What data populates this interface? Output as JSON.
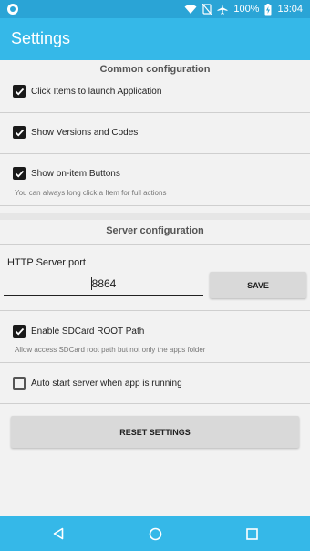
{
  "status": {
    "battery": "100%",
    "time": "13:04"
  },
  "appbar": {
    "title": "Settings"
  },
  "common": {
    "header": "Common configuration",
    "items": [
      {
        "label": "Click Items to launch Application",
        "checked": true
      },
      {
        "label": "Show Versions and Codes",
        "checked": true
      },
      {
        "label": "Show on-item Buttons",
        "checked": true,
        "hint": "You can always long click a Item for full actions"
      }
    ]
  },
  "server": {
    "header": "Server configuration",
    "port_label": "HTTP Server port",
    "port_value": "8864",
    "save_label": "SAVE",
    "sdcard": {
      "label": "Enable SDCard ROOT Path",
      "checked": true,
      "hint": "Allow access SDCard root path but not only the apps folder"
    },
    "autostart": {
      "label": "Auto start server when app is running",
      "checked": false
    },
    "reset_label": "RESET SETTINGS"
  },
  "colors": {
    "statusbar": "#2aa4d6",
    "appbar": "#35b8e8"
  }
}
